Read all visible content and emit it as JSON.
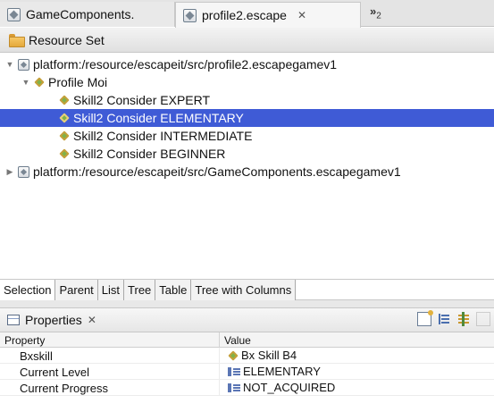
{
  "editor_tabs": [
    {
      "label": "GameComponents.",
      "active": false
    },
    {
      "label": "profile2.escape",
      "active": true,
      "close_glyph": "✕"
    }
  ],
  "tab_overflow": {
    "glyph": "»",
    "count": "2"
  },
  "resource_set": {
    "label": "Resource Set"
  },
  "tree": [
    {
      "label": "platform:/resource/escapeit/src/profile2.escapegamev1",
      "depth": 0,
      "twisty": "▼",
      "icon": "escape-file-icon",
      "selected": false
    },
    {
      "label": "Profile Moi",
      "depth": 1,
      "twisty": "▼",
      "icon": "diamond-icon",
      "selected": false
    },
    {
      "label": "Skill2 Consider EXPERT",
      "depth": 2,
      "twisty": "",
      "icon": "diamond-icon",
      "selected": false
    },
    {
      "label": "Skill2 Consider ELEMENTARY",
      "depth": 2,
      "twisty": "",
      "icon": "diamond-icon",
      "selected": true
    },
    {
      "label": "Skill2 Consider INTERMEDIATE",
      "depth": 2,
      "twisty": "",
      "icon": "diamond-icon",
      "selected": false
    },
    {
      "label": "Skill2 Consider BEGINNER",
      "depth": 2,
      "twisty": "",
      "icon": "diamond-icon",
      "selected": false
    },
    {
      "label": "platform:/resource/escapeit/src/GameComponents.escapegamev1",
      "depth": 0,
      "twisty": "▶",
      "icon": "escape-file-icon",
      "selected": false
    }
  ],
  "editor_pages": [
    "Selection",
    "Parent",
    "List",
    "Tree",
    "Table",
    "Tree with Columns"
  ],
  "properties": {
    "title": "Properties",
    "close_glyph": "✕",
    "column_property": "Property",
    "column_value": "Value",
    "rows": [
      {
        "name": "Bxskill",
        "value": "Bx Skill B4",
        "icon": "diamond-icon"
      },
      {
        "name": "Current Level",
        "value": "ELEMENTARY",
        "icon": "enum-literal-icon"
      },
      {
        "name": "Current Progress",
        "value": "NOT_ACQUIRED",
        "icon": "enum-literal-icon"
      }
    ]
  },
  "colors": {
    "selection": "#3f5bd6",
    "selection_text": "#ffffff"
  }
}
